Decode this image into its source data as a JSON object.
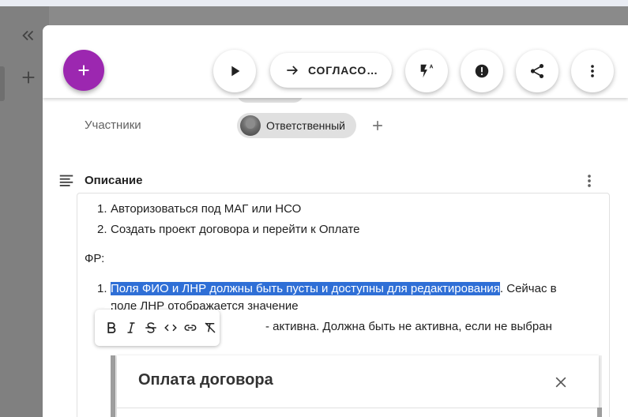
{
  "rail": {
    "collapse_icon": "double-chevron-left-icon",
    "add_icon": "plus-icon"
  },
  "toolbar": {
    "fab_icon": "plus-icon",
    "fab_color": "#9c27b0",
    "play_icon": "play-icon",
    "approve_label": "СОГЛАСО…",
    "approve_icon": "arrow-right-icon",
    "auto_icon": "flash-auto-icon",
    "alert_icon": "alert-circle-icon",
    "share_icon": "share-icon",
    "more_icon": "more-vertical-icon"
  },
  "participants": {
    "label": "Участники",
    "chip_label": "Ответственный",
    "add_icon": "plus-icon"
  },
  "description": {
    "title": "Описание",
    "steps": [
      "Авторизоваться под МАГ или НСО",
      "Создать проект договора и перейти к Оплате"
    ],
    "fr_label": "ФР:",
    "fr_item1_selected": "Поля ФИО и ЛНР должны быть пусты и доступны для редактирования",
    "fr_item1_rest": ". Сейчас в",
    "fr_item1_line2": "поле ЛНР отображается значение",
    "fr_item2_tail": "- активна. Должна быть не активна, если не выбран"
  },
  "format_toolbar": {
    "bold": "bold-icon",
    "italic": "italic-icon",
    "strike": "strikethrough-icon",
    "code": "code-icon",
    "link": "link-icon",
    "clear": "clear-format-icon"
  },
  "embedded_dialog": {
    "title": "Оплата договора",
    "close_icon": "close-icon"
  }
}
